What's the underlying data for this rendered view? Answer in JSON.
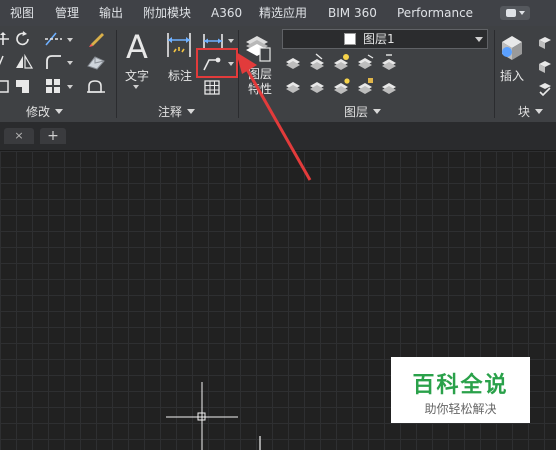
{
  "menu": {
    "tabs": [
      "视图",
      "管理",
      "输出",
      "附加模块",
      "A360",
      "精选应用",
      "BIM 360",
      "Performance"
    ]
  },
  "ribbon": {
    "modify_panel": {
      "label": "修改"
    },
    "annotation_panel": {
      "label": "注释",
      "text_label": "文字",
      "dimension_label": "标注"
    },
    "layers_panel": {
      "label": "图层",
      "layer_properties_label": "图层\n特性",
      "current_layer": "图层1"
    },
    "block_panel": {
      "label": "块",
      "insert_label": "插入"
    }
  },
  "doc_tabs": {
    "close_symbol": "×",
    "new_tab_symbol": "+"
  },
  "watermark": {
    "title": "百科全说",
    "subtitle": "助你轻松解决"
  },
  "colors": {
    "menu_bg": "#404247",
    "ribbon_bg": "#3f4144",
    "canvas_bg": "#212121",
    "highlight": "#e23b3b",
    "watermark_green": "#2aa14a"
  },
  "icons": {
    "dimension_tool": "linear-dimension-icon",
    "annotation_arrow": "red-pointer-arrow"
  }
}
